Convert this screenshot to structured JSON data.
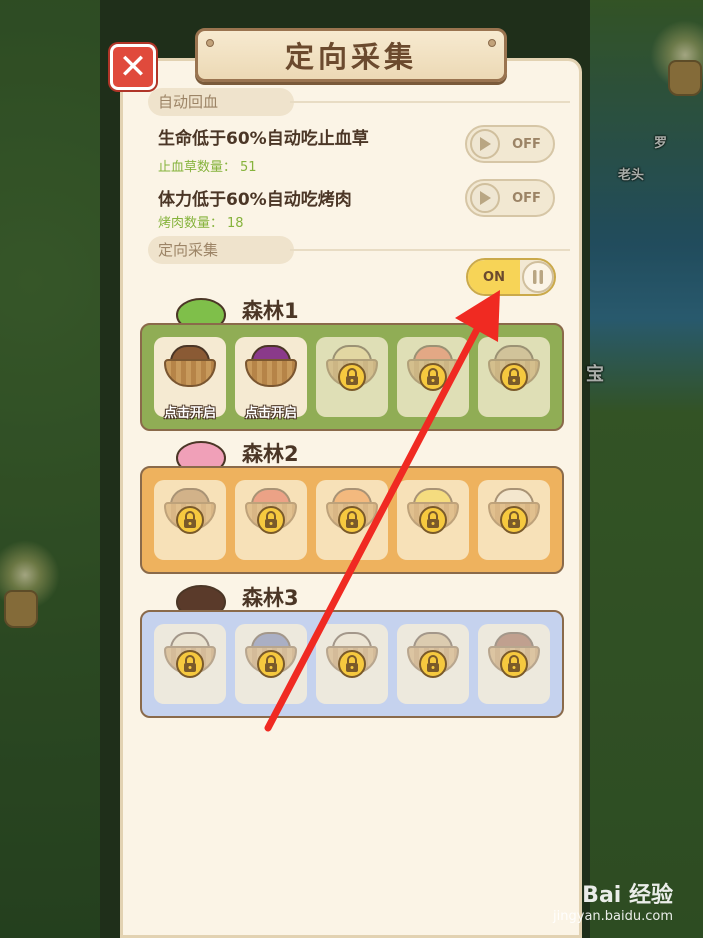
{
  "dialog": {
    "title": "定向采集",
    "close_label": "✕"
  },
  "auto_heal": {
    "section_label": "自动回血",
    "rules": [
      {
        "text": "生命低于60%自动吃止血草",
        "count_label": "止血草数量：",
        "count": "51",
        "toggle_label": "OFF",
        "toggle_state": "off"
      },
      {
        "text": "体力低于60%自动吃烤肉",
        "count_label": "烤肉数量：",
        "count": "18",
        "toggle_label": "OFF",
        "toggle_state": "off"
      }
    ]
  },
  "directed_gather": {
    "section_label": "定向采集",
    "toggle_label": "ON",
    "toggle_state": "on"
  },
  "forests": [
    {
      "name": "森林1",
      "color": "#90ad55",
      "slots": [
        {
          "item": "brown-nuts",
          "locked": false,
          "label": "点击开启"
        },
        {
          "item": "purple-berries",
          "locked": false,
          "label": "点击开启"
        },
        {
          "item": "potatoes",
          "locked": true,
          "label": ""
        },
        {
          "item": "red-fruit",
          "locked": true,
          "label": ""
        },
        {
          "item": "wood-branch",
          "locked": true,
          "label": ""
        }
      ]
    },
    {
      "name": "森林2",
      "color": "#eeb25e",
      "slots": [
        {
          "item": "brown-roots",
          "locked": true,
          "label": ""
        },
        {
          "item": "strawberries",
          "locked": true,
          "label": ""
        },
        {
          "item": "carrots",
          "locked": true,
          "label": ""
        },
        {
          "item": "yellow-lemons",
          "locked": true,
          "label": ""
        },
        {
          "item": "white-flowers",
          "locked": true,
          "label": ""
        }
      ]
    },
    {
      "name": "森林3",
      "color": "#c5d2ee",
      "slots": [
        {
          "item": "mushrooms",
          "locked": true,
          "label": ""
        },
        {
          "item": "blueberries",
          "locked": true,
          "label": ""
        },
        {
          "item": "garlic",
          "locked": true,
          "label": ""
        },
        {
          "item": "wild-potatoes",
          "locked": true,
          "label": ""
        },
        {
          "item": "wood-log",
          "locked": true,
          "label": ""
        }
      ]
    }
  ],
  "world": {
    "npc_label_1": "罗",
    "npc_label_2": "老头",
    "side_label": "宝"
  },
  "watermark": {
    "logo": "Bai 经验",
    "url": "jingyan.baidu.com"
  },
  "colors": {
    "panel_bg": "#fbf4e6",
    "title_brown": "#6b4a2e",
    "count_green": "#86b33c",
    "toggle_on_yellow": "#f7d457",
    "close_red": "#e04a3c",
    "arrow_red": "#f02a22"
  }
}
